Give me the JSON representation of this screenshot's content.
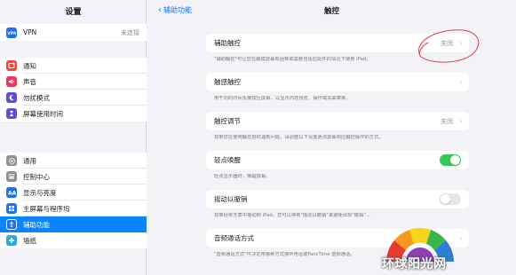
{
  "sidebar": {
    "title": "设置",
    "vpn": {
      "label": "VPN",
      "value": "未连接",
      "icon": "vpn-icon",
      "color": "#1b6ff5"
    },
    "group2": [
      {
        "label": "通知",
        "icon": "bell-icon",
        "color": "#f2453d"
      },
      {
        "label": "声音",
        "icon": "speaker-icon",
        "color": "#f2365d"
      },
      {
        "label": "勿扰模式",
        "icon": "moon-icon",
        "color": "#5b4fd6"
      },
      {
        "label": "屏幕使用时间",
        "icon": "hourglass-icon",
        "color": "#5b4fd6"
      }
    ],
    "group3": [
      {
        "label": "通用",
        "icon": "gear-icon",
        "color": "#8e8e93"
      },
      {
        "label": "控制中心",
        "icon": "switches-icon",
        "color": "#8e8e93"
      },
      {
        "label": "显示与亮度",
        "icon": "aa-icon",
        "color": "#1b6ff5"
      },
      {
        "label": "主屏幕与程序坞",
        "icon": "grid-icon",
        "color": "#1b6ff5"
      },
      {
        "label": "辅助功能",
        "icon": "accessibility-icon",
        "color": "#1b6ff5",
        "selected": true
      },
      {
        "label": "墙纸",
        "icon": "flower-icon",
        "color": "#2aa8d8"
      }
    ]
  },
  "main": {
    "back_label": "辅助功能",
    "title": "触控",
    "assistive_touch": {
      "label": "辅助触控",
      "value": "关闭",
      "note": "\"辅助触控\"可让您在触摸屏幕有困难或需要自适应配件的情况下使用 iPad。"
    },
    "haptic_touch": {
      "label": "触感触控",
      "note": "用于同的时间长度按压屏幕，以显示内容预览、操作或关联菜单。"
    },
    "touch_accommodations": {
      "label": "触控调节",
      "value": "关闭",
      "note": "如果您在使用触控屏时遇到问题，请调整以下设置更改屏幕响应触控操作的方式。"
    },
    "tap_to_wake": {
      "label": "轻点唤醒",
      "on": true,
      "note": "轻点显示器时，唤醒屏幕。"
    },
    "shake_to_undo": {
      "label": "摇动以撤销",
      "on": false,
      "note": "如果经常无意中摇动到 iPad，您可以停用\"摇动以撤销\"来避免出现\"撤销\"..."
    },
    "call_audio": {
      "label": "音频通话方式",
      "note": "\"音频通话方式\"可决定用哪种方式接听电话或FaceTime 音频通话。"
    }
  },
  "watermark": {
    "text": "环球阳光网"
  }
}
